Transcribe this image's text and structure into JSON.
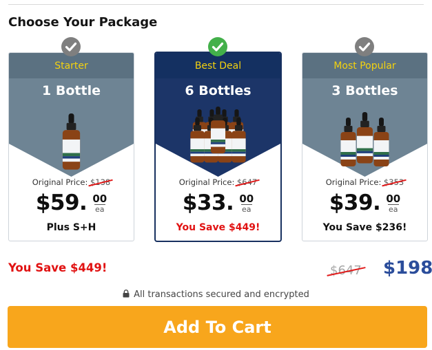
{
  "heading": "Choose Your Package",
  "packages": [
    {
      "ribbon": "Starter",
      "quantity": "1 Bottle",
      "bottle_count": 1,
      "original_label": "Original Price:",
      "original_price": "$138",
      "price_dollars": "$59.",
      "price_cents": "00",
      "price_unit": "ea",
      "note": "Plus S+H",
      "selected": false
    },
    {
      "ribbon": "Best Deal",
      "quantity": "6 Bottles",
      "bottle_count": 6,
      "original_label": "Original Price:",
      "original_price": "$647",
      "price_dollars": "$33.",
      "price_cents": "00",
      "price_unit": "ea",
      "note": "You Save $449!",
      "selected": true
    },
    {
      "ribbon": "Most Popular",
      "quantity": "3 Bottles",
      "bottle_count": 3,
      "original_label": "Original Price:",
      "original_price": "$353",
      "price_dollars": "$39.",
      "price_cents": "00",
      "price_unit": "ea",
      "note": "You Save $236!",
      "selected": false
    }
  ],
  "summary": {
    "savings": "You Save $449!",
    "old_total": "$647",
    "new_total": "$198"
  },
  "secure_text": "All transactions secured and encrypted",
  "cart_button": "Add To Cart",
  "colors": {
    "accent_yellow": "#f4d20f",
    "selected_navy": "#1c3568",
    "card_slate": "#6e8494",
    "check_green": "#43b04a",
    "savings_red": "#e11212",
    "total_blue": "#2b4d9b",
    "cart_orange": "#f8a61c"
  },
  "icons": {
    "check": "checkmark-circle-icon",
    "lock": "lock-icon",
    "product": "dropper-bottle-icon"
  }
}
